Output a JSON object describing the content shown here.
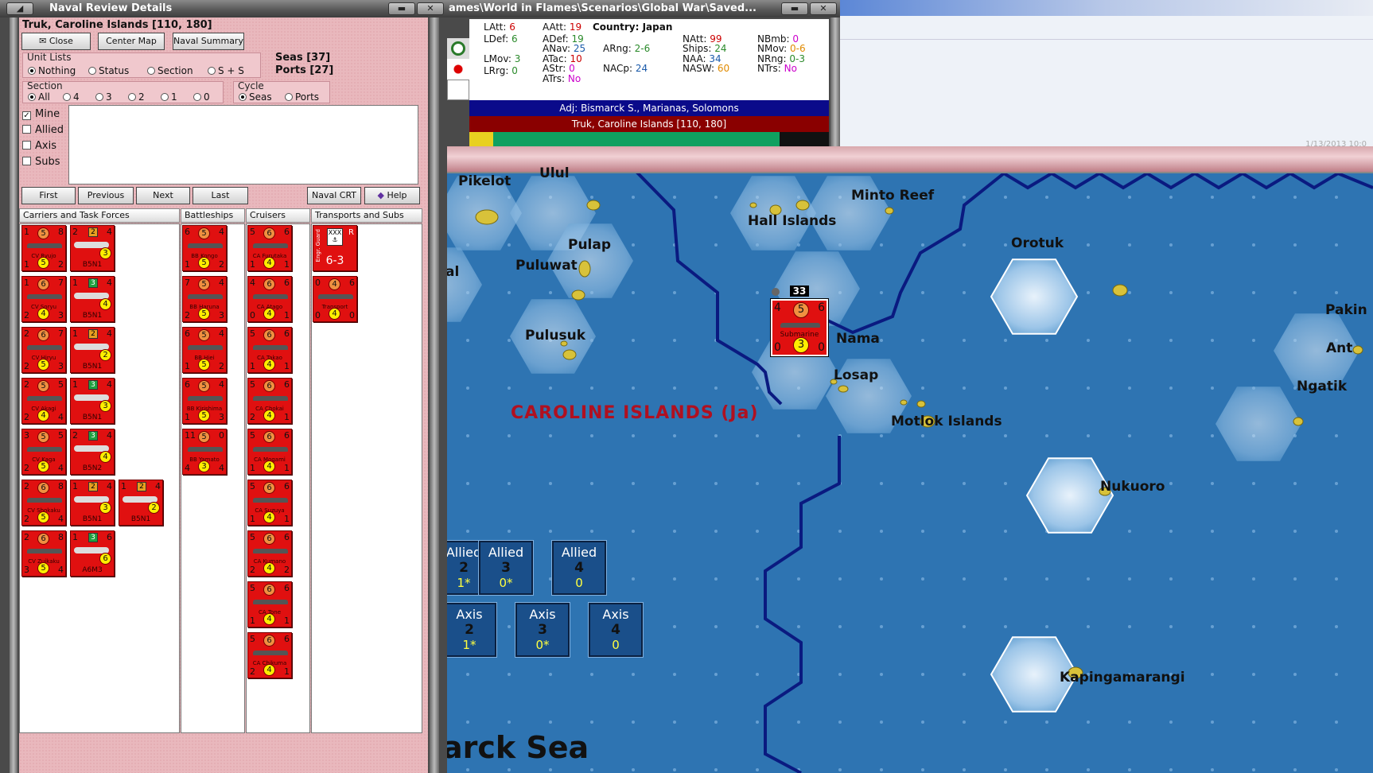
{
  "naval_window": {
    "title": "Naval Review Details",
    "location": "Truk, Caroline Islands [110, 180]",
    "buttons": {
      "close": "Close",
      "center_map": "Center Map",
      "naval_summary": "Naval Summary",
      "first": "First",
      "previous": "Previous",
      "next": "Next",
      "last": "Last",
      "naval_crt": "Naval CRT",
      "help": "Help"
    },
    "unit_lists": {
      "label": "Unit Lists",
      "options": [
        "Nothing",
        "Status",
        "Section",
        "S + S"
      ],
      "selected": "Nothing"
    },
    "section": {
      "label": "Section",
      "options": [
        "All",
        "4",
        "3",
        "2",
        "1",
        "0"
      ],
      "selected": "All"
    },
    "cycle": {
      "label": "Cycle",
      "options": [
        "Seas",
        "Ports"
      ],
      "selected": "Seas"
    },
    "seas_count": "Seas [37]",
    "ports_count": "Ports [27]",
    "filters": [
      {
        "label": "Mine",
        "checked": true
      },
      {
        "label": "Allied",
        "checked": false
      },
      {
        "label": "Axis",
        "checked": false
      },
      {
        "label": "Subs",
        "checked": false
      }
    ],
    "columns": [
      "Carriers and Task Forces",
      "Battleships",
      "Cruisers",
      "Transports and Subs"
    ],
    "carriers": [
      {
        "name": "CV Ryujo",
        "tl": "1",
        "tc": "5",
        "tr": "8",
        "bl": "1",
        "bc": "5",
        "br": "2"
      },
      {
        "name": "CV Soryu",
        "tl": "1",
        "tc": "6",
        "tr": "7",
        "bl": "2",
        "bc": "4",
        "br": "3"
      },
      {
        "name": "CV Hiryu",
        "tl": "2",
        "tc": "6",
        "tr": "7",
        "bl": "2",
        "bc": "5",
        "br": "3"
      },
      {
        "name": "CV Akagi",
        "tl": "2",
        "tc": "5",
        "tr": "5",
        "bl": "2",
        "bc": "4",
        "br": "4"
      },
      {
        "name": "CV Kaga",
        "tl": "3",
        "tc": "5",
        "tr": "5",
        "bl": "2",
        "bc": "5",
        "br": "4"
      },
      {
        "name": "CV Shokaku",
        "tl": "2",
        "tc": "6",
        "tr": "8",
        "bl": "2",
        "bc": "5",
        "br": "4"
      },
      {
        "name": "CV Zuikaku",
        "tl": "2",
        "tc": "6",
        "tr": "8",
        "bl": "3",
        "bc": "5",
        "br": "4"
      }
    ],
    "air_units": [
      {
        "name": "B5N1",
        "tl": "2",
        "sq": "2",
        "tr": "4",
        "bc": "3"
      },
      {
        "name": "B5N1",
        "tl": "1",
        "sq": "3",
        "tr": "4",
        "bc": "4"
      },
      {
        "name": "B5N1",
        "tl": "1",
        "sq": "2",
        "tr": "4",
        "bc": "2"
      },
      {
        "name": "B5N1",
        "tl": "1",
        "sq": "3",
        "tr": "4",
        "bc": "3"
      },
      {
        "name": "B5N2",
        "tl": "2",
        "sq": "3",
        "tr": "4",
        "bc": "4"
      },
      {
        "name": "B5N1",
        "tl": "1",
        "sq": "2",
        "tr": "4",
        "bc": "3"
      },
      {
        "name": "A6M3",
        "tl": "1",
        "sq": "3",
        "tr": "6",
        "bc": "6"
      }
    ],
    "extra_air": {
      "name": "B5N1",
      "tl": "1",
      "sq": "2",
      "tr": "4",
      "bc": "2"
    },
    "battleships": [
      {
        "name": "BB Kongo",
        "tl": "6",
        "tc": "5",
        "tr": "4",
        "bl": "1",
        "bc": "5",
        "br": "2"
      },
      {
        "name": "BB Haruna",
        "tl": "7",
        "tc": "5",
        "tr": "4",
        "bl": "2",
        "bc": "5",
        "br": "3"
      },
      {
        "name": "BB Hiei",
        "tl": "6",
        "tc": "5",
        "tr": "4",
        "bl": "1",
        "bc": "5",
        "br": "2"
      },
      {
        "name": "BB Kirishima",
        "tl": "6",
        "tc": "5",
        "tr": "4",
        "bl": "1",
        "bc": "5",
        "br": "3"
      },
      {
        "name": "BB Yamato",
        "tl": "11",
        "tc": "5",
        "tr": "0",
        "bl": "4",
        "bc": "3",
        "br": "4"
      }
    ],
    "cruisers": [
      {
        "name": "CA Furutaka",
        "tl": "5",
        "tc": "6",
        "tr": "6",
        "bl": "1",
        "bc": "4",
        "br": "1"
      },
      {
        "name": "CA Atago",
        "tl": "4",
        "tc": "6",
        "tr": "6",
        "bl": "0",
        "bc": "4",
        "br": "1"
      },
      {
        "name": "CA Takao",
        "tl": "5",
        "tc": "6",
        "tr": "6",
        "bl": "1",
        "bc": "4",
        "br": "1"
      },
      {
        "name": "CA Chokai",
        "tl": "5",
        "tc": "6",
        "tr": "6",
        "bl": "2",
        "bc": "4",
        "br": "1"
      },
      {
        "name": "CA Mogami",
        "tl": "5",
        "tc": "6",
        "tr": "6",
        "bl": "1",
        "bc": "4",
        "br": "1"
      },
      {
        "name": "CA Suzuya",
        "tl": "5",
        "tc": "6",
        "tr": "6",
        "bl": "1",
        "bc": "4",
        "br": "1"
      },
      {
        "name": "CA Kumano",
        "tl": "5",
        "tc": "6",
        "tr": "6",
        "bl": "2",
        "bc": "4",
        "br": "2"
      },
      {
        "name": "CA Tone",
        "tl": "5",
        "tc": "6",
        "tr": "6",
        "bl": "1",
        "bc": "4",
        "br": "1"
      },
      {
        "name": "CA Chikuma",
        "tl": "5",
        "tc": "6",
        "tr": "6",
        "bl": "2",
        "bc": "4",
        "br": "1"
      }
    ],
    "transports": [
      {
        "name": "XXX",
        "corner": "R",
        "side": "Engr. Guard",
        "value": "6-3"
      },
      {
        "name": "Transport",
        "tl": "0",
        "tc": "4",
        "tr": "6",
        "bl": "0",
        "bc": "4",
        "br": "0"
      }
    ]
  },
  "unit_panel": {
    "title": "ames\\World in Flames\\Scenarios\\Global War\\Saved...",
    "stats": [
      {
        "k": "LAtt:",
        "v": "6",
        "c": "#cc0000"
      },
      {
        "k": "LDef:",
        "v": "6",
        "c": "#2a8a2a"
      },
      {
        "k": "LMov:",
        "v": "3",
        "c": "#2a8a2a"
      },
      {
        "k": "LRrg:",
        "v": "0",
        "c": "#2a8a2a"
      },
      {
        "k": "AAtt:",
        "v": "19",
        "c": "#cc0000"
      },
      {
        "k": "ADef:",
        "v": "19",
        "c": "#2a8a2a"
      },
      {
        "k": "ANav:",
        "v": "25",
        "c": "#1a5aaa"
      },
      {
        "k": "ATac:",
        "v": "10",
        "c": "#cc0000"
      },
      {
        "k": "AStr:",
        "v": "0",
        "c": "#cc00cc"
      },
      {
        "k": "ATrs:",
        "v": "No",
        "c": "#cc00cc"
      },
      {
        "k": "ARng:",
        "v": "2-6",
        "c": "#2a8a2a"
      },
      {
        "k": "NACp:",
        "v": "24",
        "c": "#1a5aaa"
      },
      {
        "k": "NAtt:",
        "v": "99",
        "c": "#cc0000"
      },
      {
        "k": "Ships:",
        "v": "24",
        "c": "#2a8a2a"
      },
      {
        "k": "NAA:",
        "v": "34",
        "c": "#1a5aaa"
      },
      {
        "k": "NASW:",
        "v": "60",
        "c": "#e08a00"
      },
      {
        "k": "NBmb:",
        "v": "0",
        "c": "#cc00cc"
      },
      {
        "k": "NMov:",
        "v": "0-6",
        "c": "#e08a00"
      },
      {
        "k": "NRng:",
        "v": "0-3",
        "c": "#2a8a2a"
      },
      {
        "k": "NTrs:",
        "v": "No",
        "c": "#cc00cc"
      }
    ],
    "country": "Country: Japan",
    "adjacent": "Adj: Bismarck S., Marianas, Solomons",
    "location": "Truk, Caroline Islands [110, 180]"
  },
  "other_window": {
    "stamp": "1/13/2013 10:0"
  },
  "map": {
    "islands": [
      "Pikelot",
      "Ulul",
      "Hall Islands",
      "Minto Reef",
      "Pulap",
      "Puluwat",
      "al",
      "Pulusuk",
      "Orotuk",
      "Nama",
      "Losap",
      "Motlok Islands",
      "Pakin",
      "Ant",
      "Ngatik",
      "Nukuoro",
      "Kapingamarangi"
    ],
    "region": "CAROLINE ISLANDS (Ja)",
    "sea": "arck Sea",
    "submarine": {
      "name": "Submarine",
      "tl": "4",
      "tc": "5",
      "tr": "6",
      "bl": "0",
      "bc": "3",
      "br": "0",
      "stack": "33"
    },
    "control_boxes": [
      {
        "side": "Allied",
        "section": "2",
        "value": "1*"
      },
      {
        "side": "Allied",
        "section": "3",
        "value": "0*"
      },
      {
        "side": "Allied",
        "section": "4",
        "value": "0"
      },
      {
        "side": "Axis",
        "section": "2",
        "value": "1*"
      },
      {
        "side": "Axis",
        "section": "3",
        "value": "0*"
      },
      {
        "side": "Axis",
        "section": "4",
        "value": "0"
      }
    ]
  }
}
